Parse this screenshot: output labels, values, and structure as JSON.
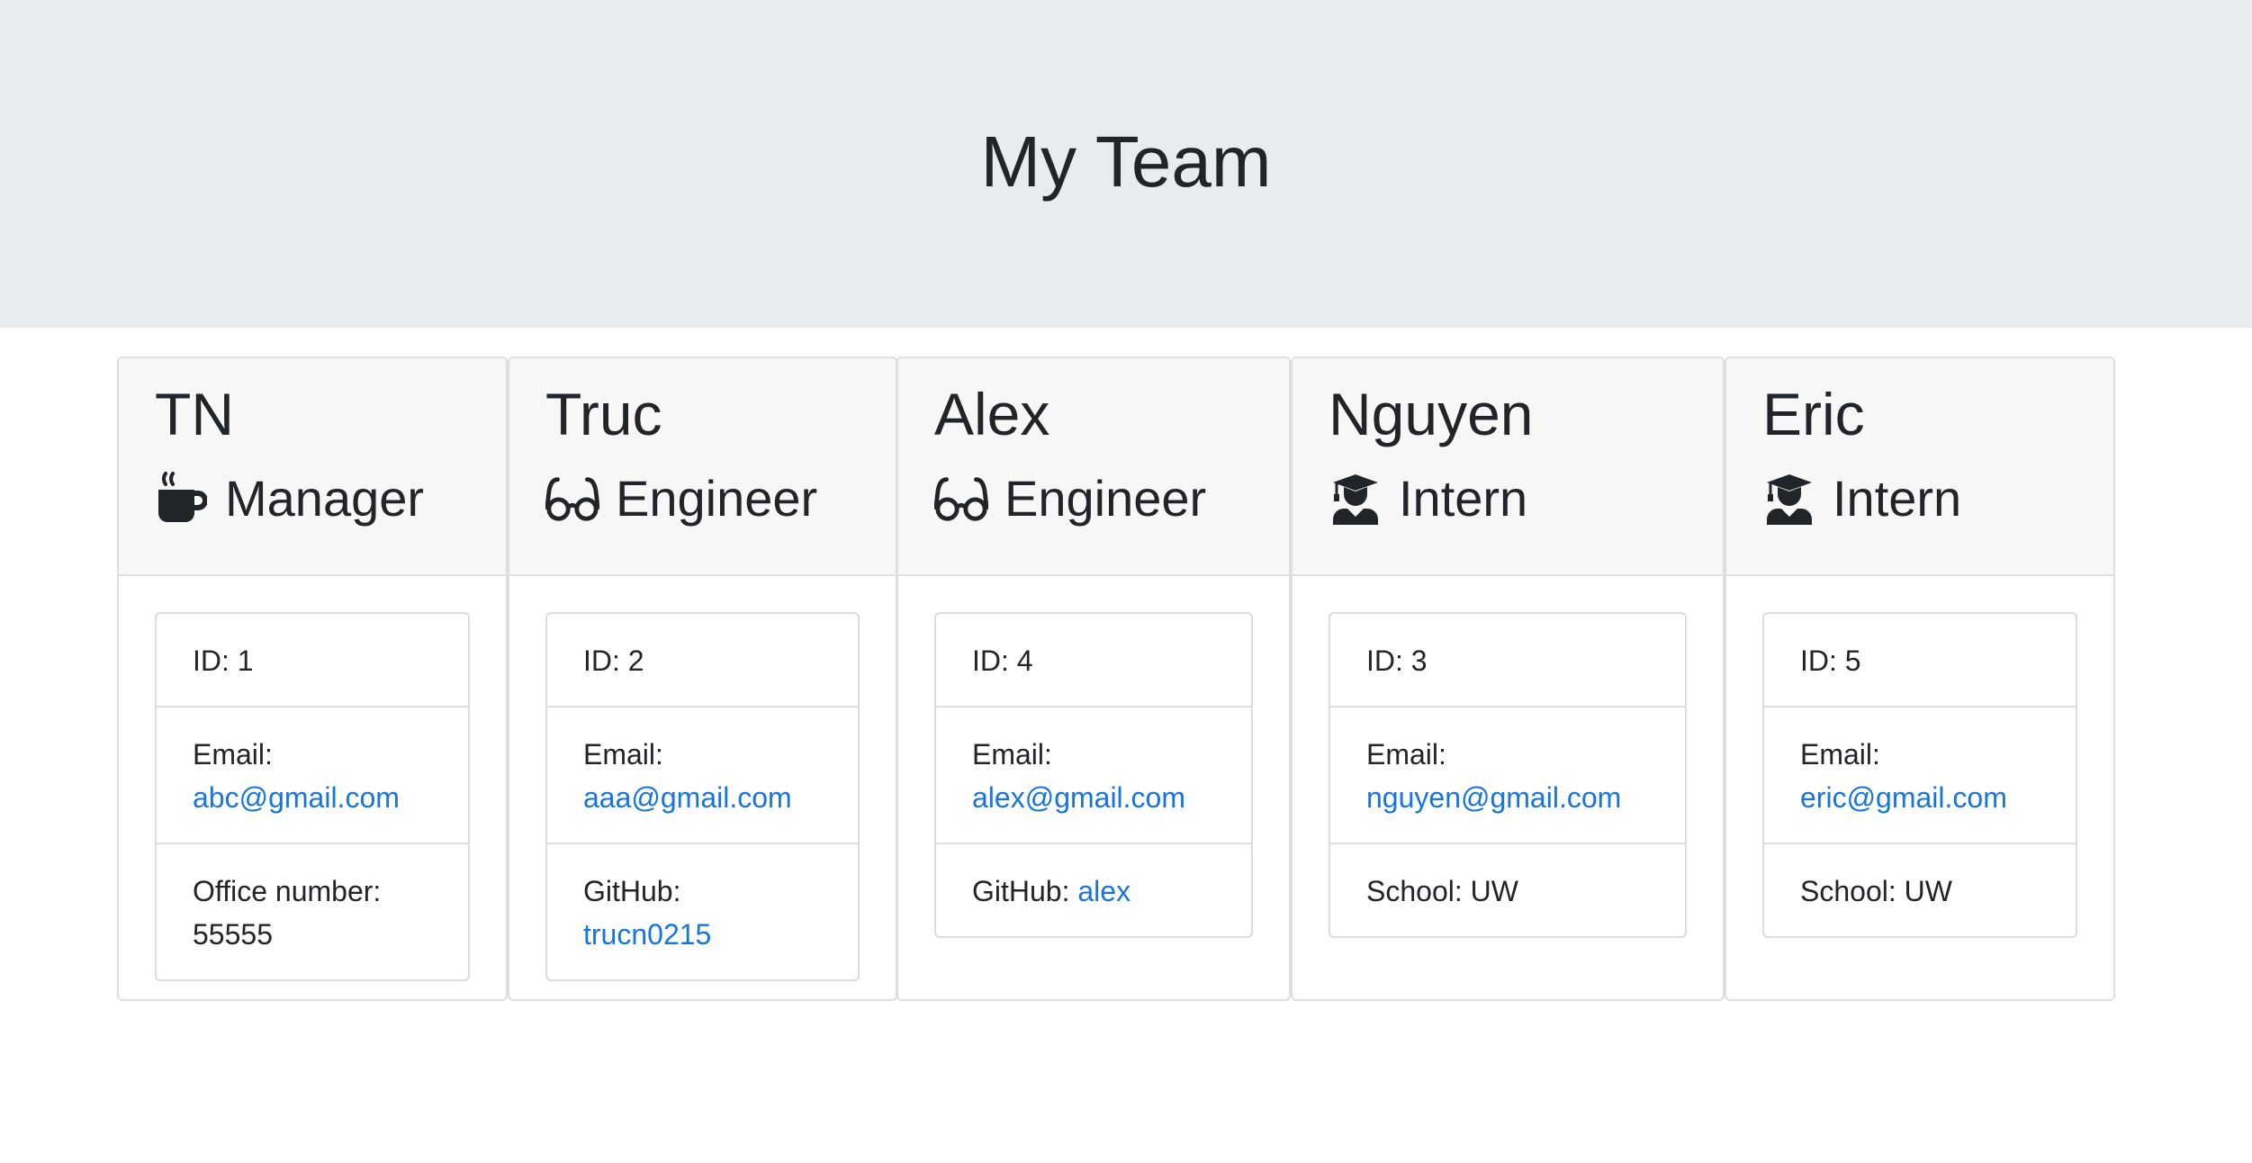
{
  "header": {
    "title": "My Team"
  },
  "employees": [
    {
      "name": "TN",
      "role": "Manager",
      "icon": "mug-icon",
      "id_text": "ID: 1",
      "email_label": "Email:",
      "email": "abc@gmail.com",
      "extra_label": "Office number:",
      "extra_value": "55555"
    },
    {
      "name": "Truc",
      "role": "Engineer",
      "icon": "glasses-icon",
      "id_text": "ID: 2",
      "email_label": "Email:",
      "email": "aaa@gmail.com",
      "extra_label": "GitHub:",
      "extra_value": "trucn0215"
    },
    {
      "name": "Alex",
      "role": "Engineer",
      "icon": "glasses-icon",
      "id_text": "ID: 4",
      "email_label": "Email:",
      "email": "alex@gmail.com",
      "extra_label": "GitHub:",
      "extra_value": "alex"
    },
    {
      "name": "Nguyen",
      "role": "Intern",
      "icon": "graduate-icon",
      "id_text": "ID: 3",
      "email_label": "Email:",
      "email": "nguyen@gmail.com",
      "extra_label": "School:",
      "extra_value": "UW"
    },
    {
      "name": "Eric",
      "role": "Intern",
      "icon": "graduate-icon",
      "id_text": "ID: 5",
      "email_label": "Email:",
      "email": "eric@gmail.com",
      "extra_label": "School:",
      "extra_value": "UW"
    }
  ],
  "colors": {
    "jumbotron_bg": "#e9ecef",
    "card_header_bg": "#f7f7f7",
    "link": "#1675e0",
    "text": "#212529"
  }
}
